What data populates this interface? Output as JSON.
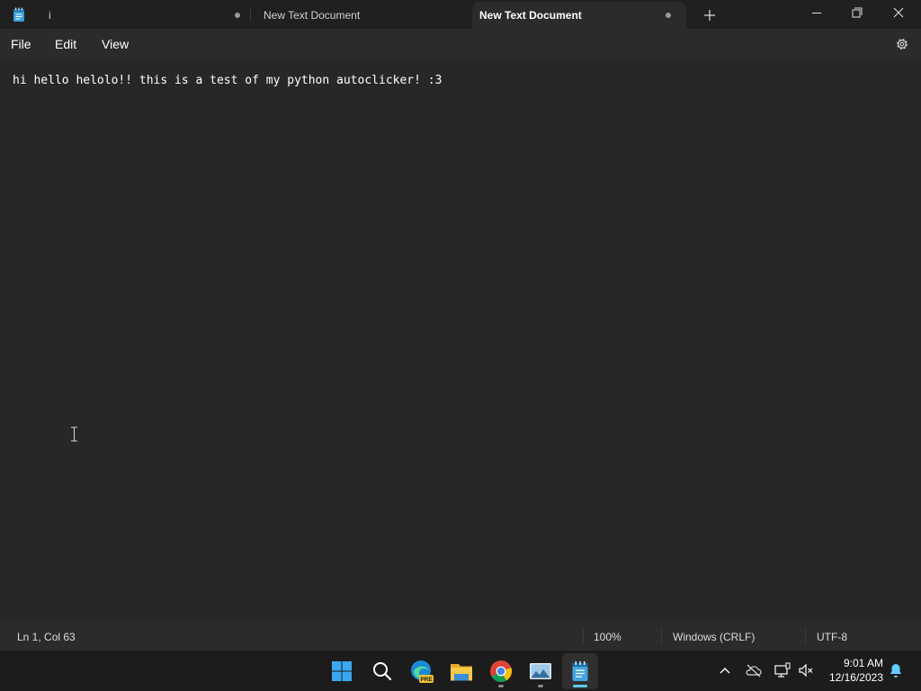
{
  "tabs": [
    {
      "label": "i",
      "modified": true
    },
    {
      "label": "New Text Document",
      "modified": false
    },
    {
      "label": "New Text Document",
      "modified": true,
      "active": true
    }
  ],
  "window_controls": {
    "minimize": "minimize-icon",
    "maximize": "restore-icon",
    "close": "close-icon"
  },
  "menu": {
    "file": "File",
    "edit": "Edit",
    "view": "View"
  },
  "editor": {
    "content": "hi hello helolo!! this is a test of my python autoclicker! :3"
  },
  "status": {
    "position": "Ln 1, Col 63",
    "zoom": "100%",
    "line_ending": "Windows (CRLF)",
    "encoding": "UTF-8"
  },
  "taskbar": {
    "apps": [
      "start-icon",
      "search-icon",
      "edge-dev-icon",
      "file-explorer-icon",
      "chrome-icon",
      "photos-icon",
      "notepad-icon"
    ],
    "edge_badge": "PRE"
  },
  "clock": {
    "time": "9:01 AM",
    "date": "12/16/2023"
  },
  "colors": {
    "accent": "#60cdff",
    "background": "#272727",
    "taskbar": "#1c1c1c"
  }
}
